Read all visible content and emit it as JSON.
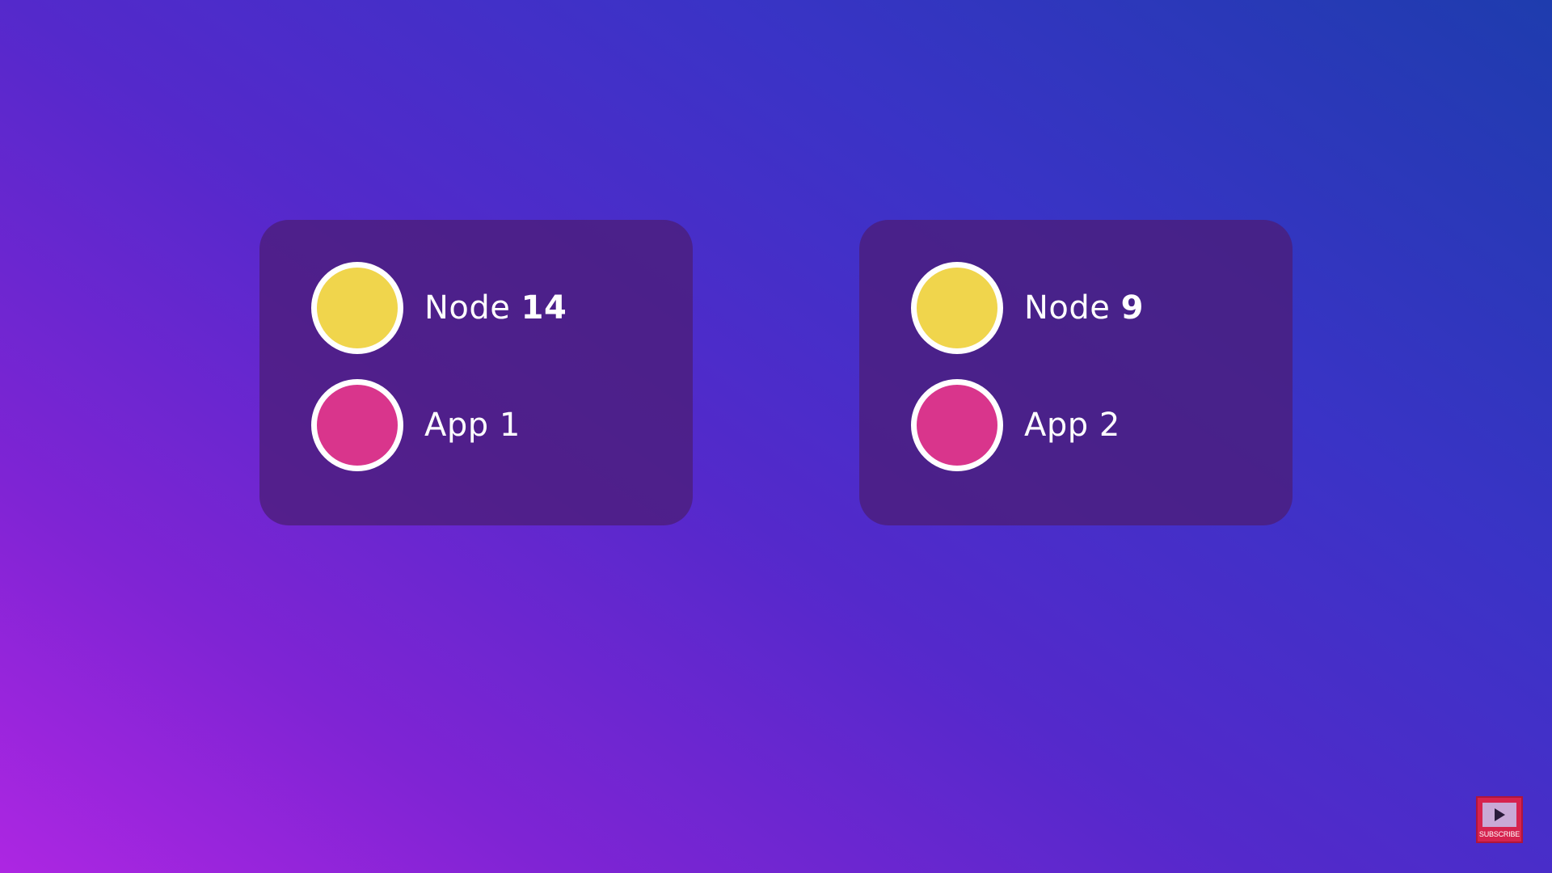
{
  "cards": [
    {
      "node": {
        "prefix": "Node",
        "number": "14",
        "color": "#f0d54c"
      },
      "app": {
        "label": "App 1",
        "color": "#d9358c"
      }
    },
    {
      "node": {
        "prefix": "Node",
        "number": "9",
        "color": "#f0d54c"
      },
      "app": {
        "label": "App 2",
        "color": "#d9358c"
      }
    }
  ],
  "subscribe": {
    "label": "SUBSCRIBE",
    "icon": "play-icon",
    "color": "#d6234e"
  },
  "background": {
    "gradient_colors": [
      "#1e3cae",
      "#5429cb",
      "#ad26e2"
    ]
  }
}
